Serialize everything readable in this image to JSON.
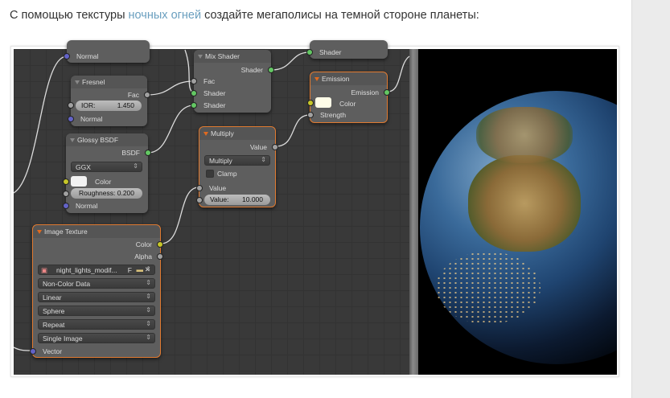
{
  "intro": {
    "before": "С помощью текстуры ",
    "link": "ночных огней",
    "after": " создайте мегаполисы на темной стороне планеты:"
  },
  "nodes": {
    "top_left": {
      "normal": "Normal"
    },
    "fresnel": {
      "title": "Fresnel",
      "fac": "Fac",
      "ior_label": "IOR:",
      "ior_value": "1.450",
      "normal": "Normal"
    },
    "glossy": {
      "title": "Glossy BSDF",
      "bsdf": "BSDF",
      "distribution": "GGX",
      "color": "Color",
      "roughness": "Roughness: 0.200",
      "normal": "Normal"
    },
    "mix": {
      "title": "Mix Shader",
      "shader_out": "Shader",
      "fac": "Fac",
      "shader1": "Shader",
      "shader2": "Shader"
    },
    "top_right": {
      "shader": "Shader"
    },
    "emission": {
      "title": "Emission",
      "emission": "Emission",
      "color": "Color",
      "strength": "Strength"
    },
    "multiply": {
      "title": "Multiply",
      "value_out": "Value",
      "operation": "Multiply",
      "clamp": "Clamp",
      "value_in": "Value",
      "value_label": "Value:",
      "value": "10.000"
    },
    "image": {
      "title": "Image Texture",
      "color": "Color",
      "alpha": "Alpha",
      "file": "night_lights_modif...",
      "fake_user": "F",
      "color_space": "Non-Color Data",
      "interpolation": "Linear",
      "projection": "Sphere",
      "extension": "Repeat",
      "source": "Single Image",
      "vector": "Vector"
    }
  },
  "colors": {
    "link": "#6a9fbf",
    "selected_border": "#e07a30",
    "shader_socket": "#63c763",
    "color_socket": "#c7c729",
    "vector_socket": "#6363c7",
    "value_socket": "#a1a1a1"
  }
}
